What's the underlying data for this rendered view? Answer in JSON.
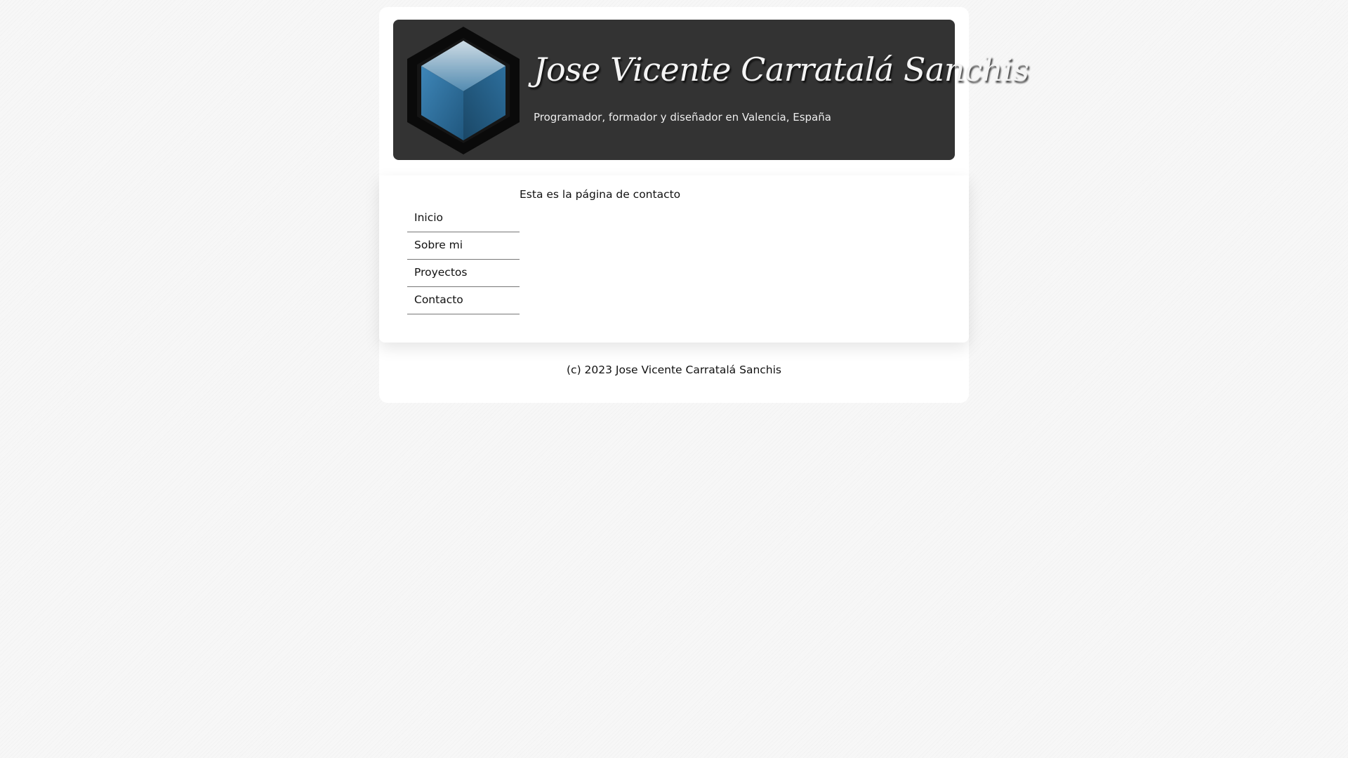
{
  "header": {
    "title": "Jose Vicente Carratalá Sanchis",
    "tagline": "Programador, formador y diseñador en Valencia, España",
    "logo_icon": "blue-hexagon-cube-icon"
  },
  "nav": {
    "items": [
      {
        "label": "Inicio"
      },
      {
        "label": "Sobre mi"
      },
      {
        "label": "Proyectos"
      },
      {
        "label": "Contacto"
      }
    ]
  },
  "main": {
    "text": "Esta es la página de contacto"
  },
  "footer": {
    "text": "(c) 2023 Jose Vicente Carratalá Sanchis"
  },
  "colors": {
    "header_bg": "#333333",
    "logo_blue": "#2a6f9c",
    "page_bg": "#ffffff"
  }
}
